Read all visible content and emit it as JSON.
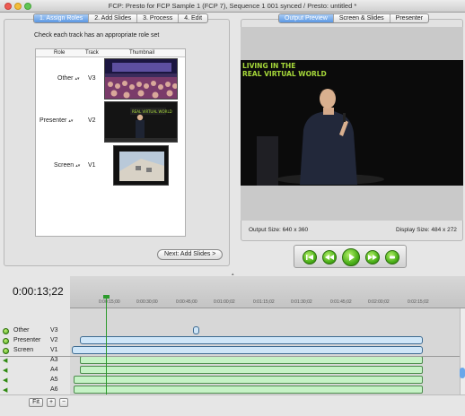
{
  "window": {
    "title": "FCP: Presto for FCP Sample 1 (FCP 7), Sequence 1 001 synced / Presto: untitled *"
  },
  "steps": [
    "1. Assign Roles",
    "2. Add Slides",
    "3. Process",
    "4. Edit"
  ],
  "instruction": "Check each track has an appropriate role set",
  "role_table": {
    "headers": {
      "role": "Role",
      "track": "Track",
      "thumbnail": "Thumbnail"
    },
    "rows": [
      {
        "role": "Other",
        "track": "V3",
        "thumb_icon": "audience-crowd-image"
      },
      {
        "role": "Presenter",
        "track": "V2",
        "thumb_icon": "presenter-stage-image"
      },
      {
        "role": "Screen",
        "track": "V1",
        "thumb_icon": "building-exterior-image"
      }
    ]
  },
  "next_button": "Next: Add Slides >",
  "preview_tabs": [
    "Output Preview",
    "Screen & Slides",
    "Presenter"
  ],
  "preview": {
    "slide_text_line1": "LIVING IN THE",
    "slide_text_line2": "REAL VIRTUAL WORLD",
    "output_size": "Output Size: 640 x 360",
    "display_size": "Display Size: 484 x 272"
  },
  "transport": [
    "go-to-start-icon",
    "rewind-icon",
    "play-icon",
    "fast-forward-icon",
    "go-to-end-icon"
  ],
  "timeline": {
    "timecode": "0:00:13;22",
    "ruler_ticks": [
      "0:00:15;00",
      "0:00:30;00",
      "0:00:45;00",
      "0:01:00;02",
      "0:01:15;02",
      "0:01:30;02",
      "0:01:45;02",
      "0:02:00;02",
      "0:02:15;02"
    ],
    "tracks": [
      {
        "name": "Other",
        "id": "V3",
        "type": "video"
      },
      {
        "name": "Presenter",
        "id": "V2",
        "type": "video"
      },
      {
        "name": "Screen",
        "id": "V1",
        "type": "video"
      },
      {
        "name": "",
        "id": "A3",
        "type": "audio"
      },
      {
        "name": "",
        "id": "A4",
        "type": "audio"
      },
      {
        "name": "",
        "id": "A5",
        "type": "audio"
      },
      {
        "name": "",
        "id": "A6",
        "type": "audio"
      }
    ]
  },
  "bottom": {
    "fit": "Fit",
    "plus": "+",
    "minus": "−"
  }
}
